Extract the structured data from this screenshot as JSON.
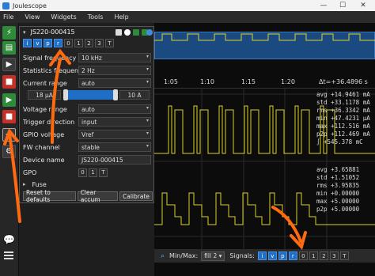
{
  "window": {
    "title": "Joulescope",
    "minimize": "—",
    "maximize": "☐",
    "close": "✕"
  },
  "menu": [
    "File",
    "View",
    "Widgets",
    "Tools",
    "Help"
  ],
  "colors": {
    "accent": "#1f6fc6",
    "trace": "#d9d12a",
    "orange_annotation": "#ff6a10"
  },
  "device_panel": {
    "device": "JS220-000415",
    "signals": [
      "i",
      "v",
      "p",
      "r",
      "0",
      "1",
      "2",
      "3",
      "T"
    ],
    "signals_on": [
      "i",
      "v",
      "p",
      "r"
    ],
    "params": [
      {
        "label": "Signal frequency",
        "value": "10 kHz"
      },
      {
        "label": "Statistics frequency",
        "value": "2 Hz"
      },
      {
        "label": "Current range",
        "value": "auto"
      }
    ],
    "range_low": "18 µA",
    "range_high": "10 A",
    "params2": [
      {
        "label": "Voltage range",
        "value": "auto"
      },
      {
        "label": "Trigger direction",
        "value": "input"
      },
      {
        "label": "GPIO voltage",
        "value": "Vref"
      },
      {
        "label": "FW channel",
        "value": "stable"
      }
    ],
    "device_name_label": "Device name",
    "device_name_value": "JS220-000415",
    "gpo_label": "GPO",
    "gpo_buttons": [
      "0",
      "1",
      "T"
    ],
    "fuse_label": "Fuse",
    "buttons": [
      "Reset to defaults",
      "Clear accum",
      "Calibrate"
    ]
  },
  "waveform": {
    "time_ticks": [
      "1:05",
      "1:10",
      "1:15",
      "1:20"
    ],
    "delta_t": "Δt=+36.4896 s",
    "current_stats": [
      [
        "avg",
        "+14.9461",
        "mA"
      ],
      [
        "std",
        "+33.1178",
        "mA"
      ],
      [
        "rms",
        "+36.3342",
        "mA"
      ],
      [
        "min",
        "+47.4231",
        "µA"
      ],
      [
        "max",
        "+112.516",
        "mA"
      ],
      [
        "p2p",
        "+112.469",
        "mA"
      ],
      [
        "∫",
        "+545.378",
        "mC"
      ]
    ],
    "voltage_stats": [
      [
        "avg",
        "+3.65881",
        ""
      ],
      [
        "std",
        "+1.51052",
        ""
      ],
      [
        "rms",
        "+3.95835",
        ""
      ],
      [
        "min",
        "+0.00000",
        ""
      ],
      [
        "max",
        "+5.00000",
        ""
      ],
      [
        "p2p",
        "+5.00000",
        ""
      ]
    ]
  },
  "bottombar": {
    "minmax_label": "Min/Max:",
    "minmax_value": "fill 2",
    "signals_label": "Signals:",
    "signals": [
      "i",
      "v",
      "p",
      "r",
      "0",
      "1",
      "2",
      "3",
      "T"
    ],
    "signals_on": [
      "i",
      "v",
      "p",
      "r"
    ]
  }
}
